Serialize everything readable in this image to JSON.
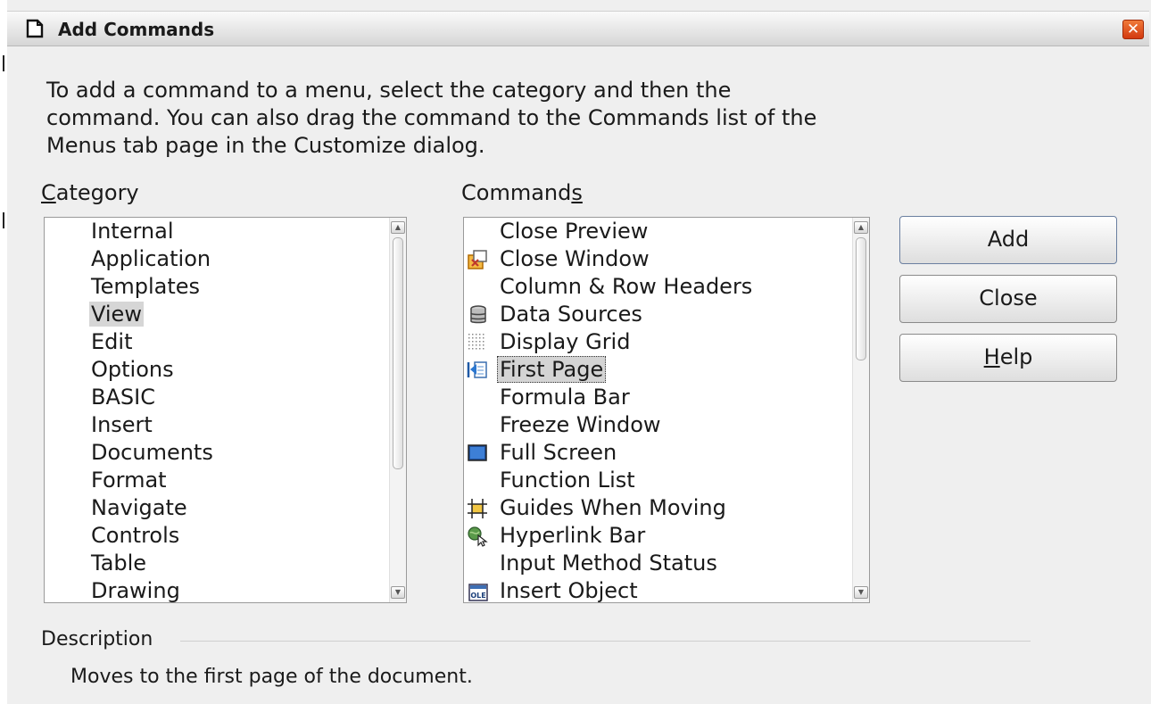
{
  "dialog": {
    "title": "Add Commands",
    "close_symbol": "✕",
    "intro": "To add a command to a menu, select the category and then the command. You can also drag the command to the Commands list of the Menus tab page in the Customize dialog."
  },
  "category": {
    "label_first": "C",
    "label_rest": "ategory",
    "items": [
      "Internal",
      "Application",
      "Templates",
      "View",
      "Edit",
      "Options",
      "BASIC",
      "Insert",
      "Documents",
      "Format",
      "Navigate",
      "Controls",
      "Table",
      "Drawing"
    ],
    "highlighted": "View"
  },
  "commands": {
    "label_main": "Command",
    "label_underlined": "s",
    "items": [
      {
        "label": "Close Preview",
        "icon": ""
      },
      {
        "label": "Close Window",
        "icon": "close-window-icon"
      },
      {
        "label": "Column & Row Headers",
        "icon": ""
      },
      {
        "label": "Data Sources",
        "icon": "database-icon"
      },
      {
        "label": "Display Grid",
        "icon": "grid-icon"
      },
      {
        "label": "First Page",
        "icon": "first-page-icon"
      },
      {
        "label": "Formula Bar",
        "icon": ""
      },
      {
        "label": "Freeze Window",
        "icon": ""
      },
      {
        "label": "Full Screen",
        "icon": "full-screen-icon"
      },
      {
        "label": "Function List",
        "icon": ""
      },
      {
        "label": "Guides When Moving",
        "icon": "guides-icon"
      },
      {
        "label": "Hyperlink Bar",
        "icon": "hyperlink-icon"
      },
      {
        "label": "Input Method Status",
        "icon": ""
      },
      {
        "label": "Insert Object",
        "icon": "ole-object-icon"
      }
    ],
    "selected": "First Page"
  },
  "buttons": {
    "add": "Add",
    "close": "Close",
    "help_first": "H",
    "help_rest": "elp"
  },
  "description": {
    "label": "Description",
    "text": "Moves to the first page of the document."
  }
}
